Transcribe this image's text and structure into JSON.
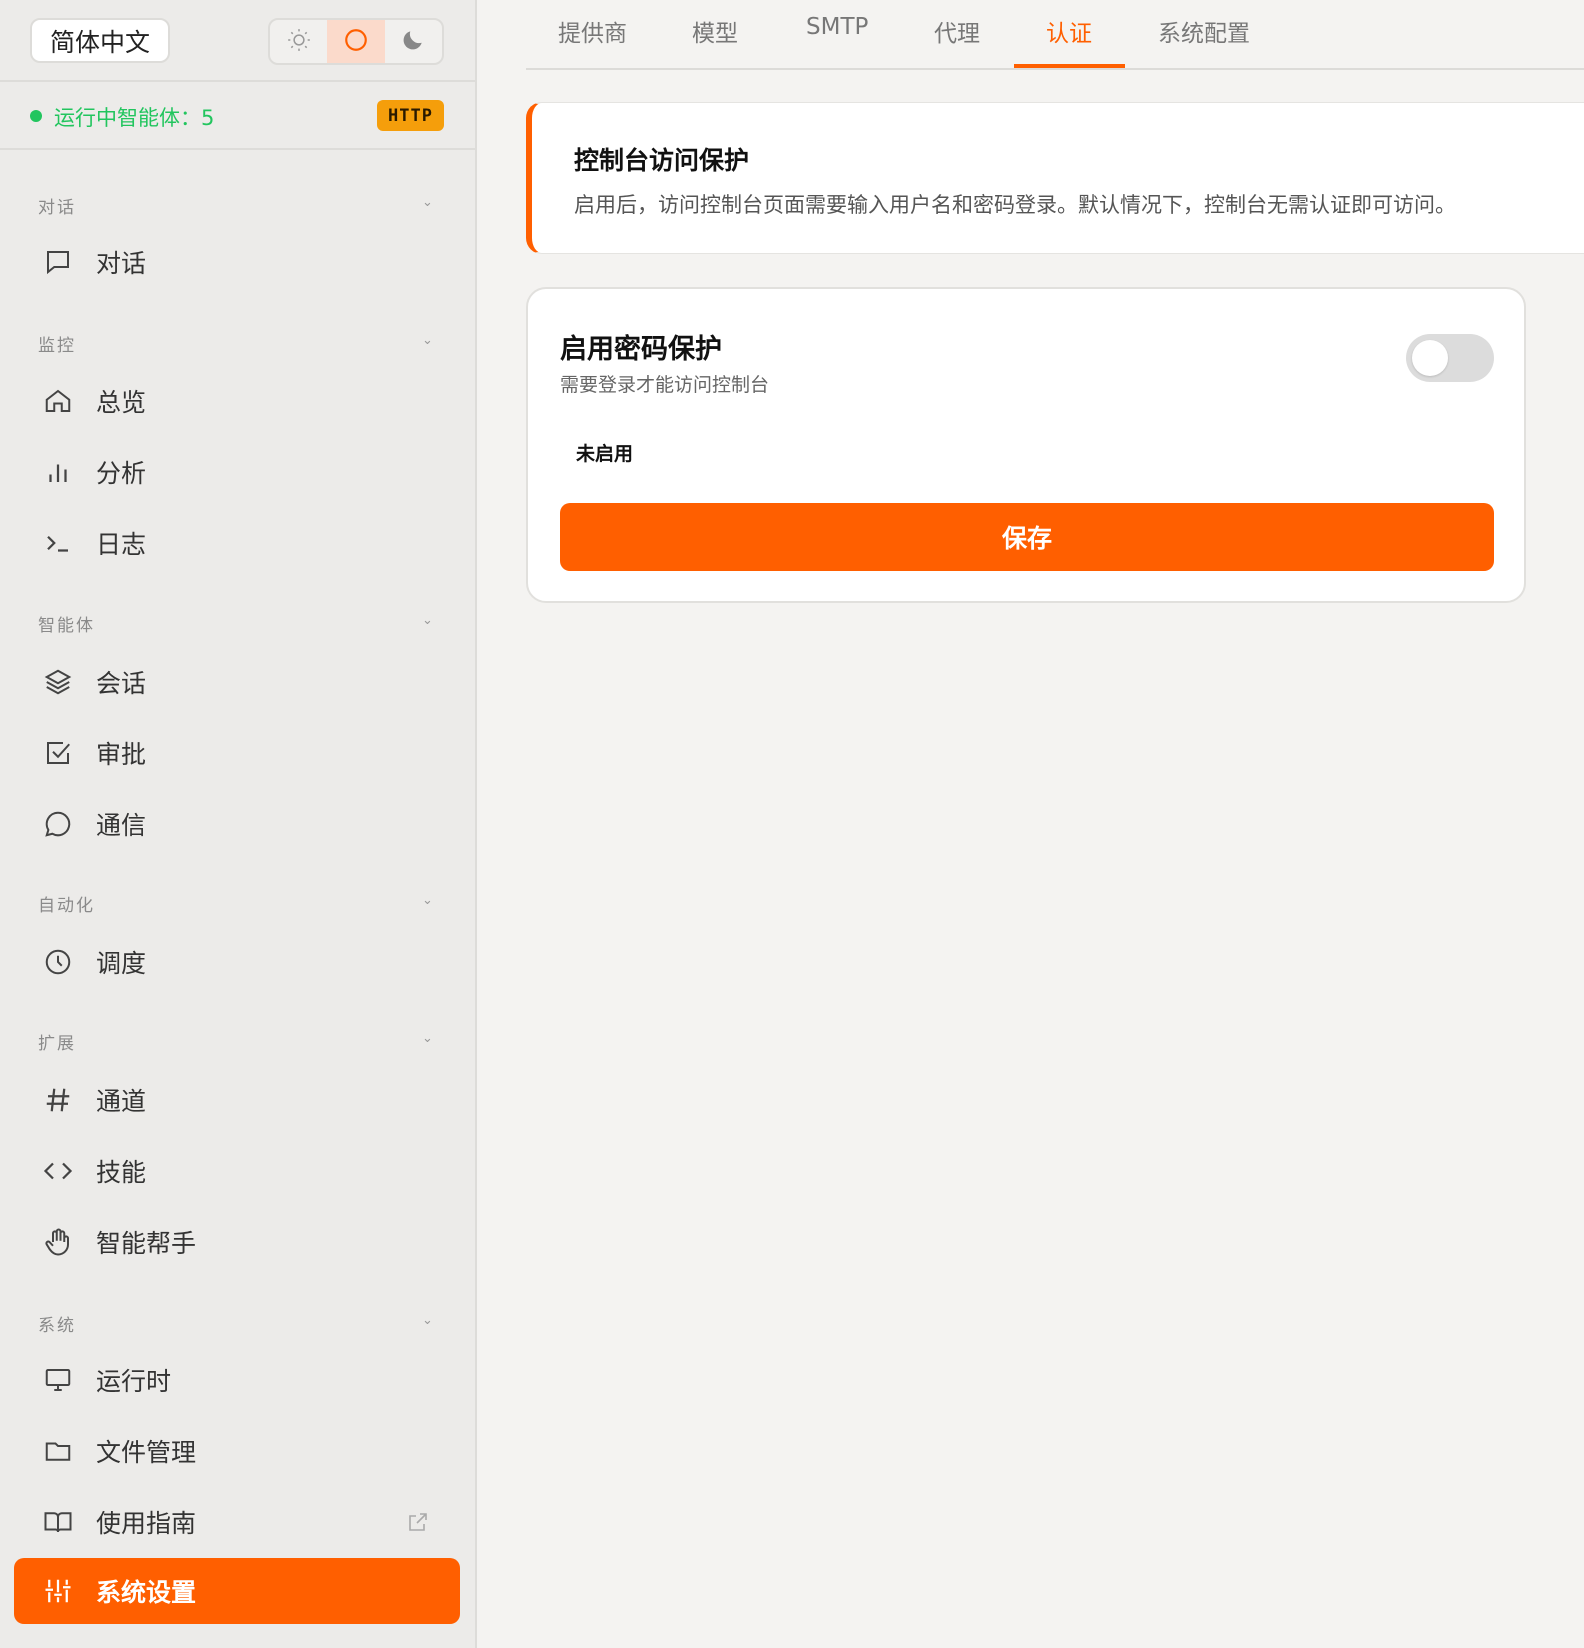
{
  "header": {
    "language_label": "简体中文",
    "theme_options": [
      {
        "icon": "sun-icon"
      },
      {
        "icon": "circle-icon",
        "active": true
      },
      {
        "icon": "moon-icon"
      }
    ]
  },
  "status": {
    "running_agents_text": "运行中智能体：5",
    "protocol_badge": "HTTP",
    "dot_color": "#22c55e"
  },
  "sidebar": {
    "sections": [
      {
        "label": "对话",
        "items": [
          {
            "label": "对话",
            "icon": "chat-bubble-icon"
          }
        ]
      },
      {
        "label": "监控",
        "items": [
          {
            "label": "总览",
            "icon": "home-icon"
          },
          {
            "label": "分析",
            "icon": "bar-chart-icon"
          },
          {
            "label": "日志",
            "icon": "terminal-icon"
          }
        ]
      },
      {
        "label": "智能体",
        "items": [
          {
            "label": "会话",
            "icon": "layers-icon"
          },
          {
            "label": "审批",
            "icon": "checkbox-icon"
          },
          {
            "label": "通信",
            "icon": "message-circle-icon"
          }
        ]
      },
      {
        "label": "自动化",
        "items": [
          {
            "label": "调度",
            "icon": "clock-icon"
          }
        ]
      },
      {
        "label": "扩展",
        "items": [
          {
            "label": "通道",
            "icon": "hash-icon"
          },
          {
            "label": "技能",
            "icon": "code-icon"
          },
          {
            "label": "智能帮手",
            "icon": "hand-icon"
          }
        ]
      },
      {
        "label": "系统",
        "items": [
          {
            "label": "运行时",
            "icon": "monitor-icon"
          },
          {
            "label": "文件管理",
            "icon": "folder-icon"
          },
          {
            "label": "使用指南",
            "icon": "book-icon",
            "external": true
          },
          {
            "label": "系统设置",
            "icon": "sliders-icon",
            "active": true
          }
        ]
      }
    ]
  },
  "tabs": [
    {
      "label": "提供商"
    },
    {
      "label": "模型"
    },
    {
      "label": "SMTP"
    },
    {
      "label": "代理"
    },
    {
      "label": "认证",
      "active": true
    },
    {
      "label": "系统配置"
    }
  ],
  "info_card": {
    "title": "控制台访问保护",
    "description": "启用后，访问控制台页面需要输入用户名和密码登录。默认情况下，控制台无需认证即可访问。"
  },
  "password_protection": {
    "title": "启用密码保护",
    "subtitle": "需要登录才能访问控制台",
    "enabled": false,
    "status_text": "未启用",
    "save_label": "保存"
  },
  "colors": {
    "accent": "#ff5f00",
    "badge": "#f59e0b",
    "background": "#f4f3f1"
  }
}
